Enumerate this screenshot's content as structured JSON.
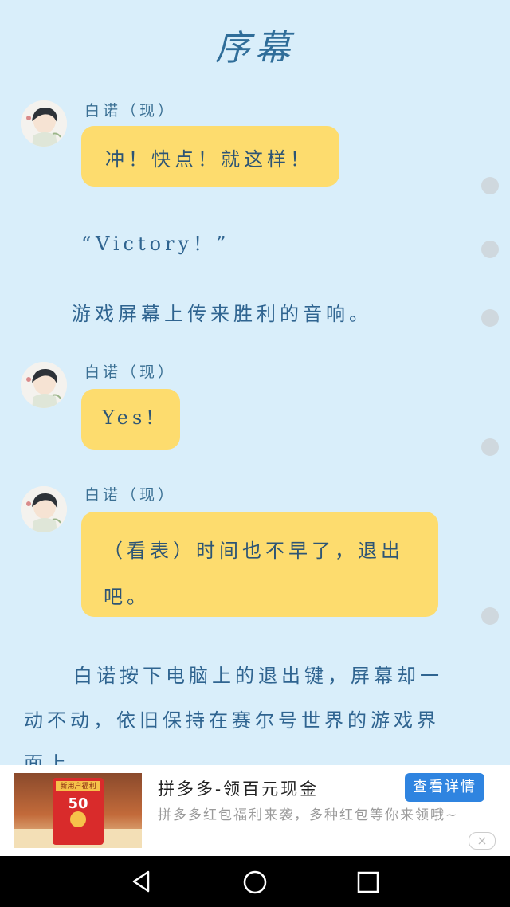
{
  "chapter_title": "序幕",
  "messages": [
    {
      "speaker": "白诺（现）",
      "text": "冲！快点！就这样！"
    },
    {
      "speaker": "白诺（现）",
      "text": "Yes!"
    },
    {
      "speaker": "白诺（现）",
      "text_line1": "（看表）时间也不早了，退出",
      "text_line2": "吧。"
    }
  ],
  "narration": {
    "victory": "“Victory！”",
    "sound": "游戏屏幕上传来胜利的音响。",
    "line1": "白诺按下电脑上的退出键，屏幕却一",
    "line2": "动不动，依旧保持在赛尔号世界的游戏界",
    "line3": "面上。"
  },
  "ad": {
    "title": "拼多多-领百元现金",
    "description": "拼多多红包福利来袭，多种红包等你来领哦~",
    "cta_label": "查看详情",
    "image_badge": "50",
    "image_banner": "新用户福利",
    "close_icon": "×"
  },
  "navbar": {
    "back_icon": "nav-back-triangle",
    "home_icon": "nav-home-circle",
    "recents_icon": "nav-recents-square"
  },
  "colors": {
    "background": "#d9eefa",
    "bubble": "#fddc6e",
    "text": "#2f6490",
    "ad_button": "#2f84e0"
  }
}
